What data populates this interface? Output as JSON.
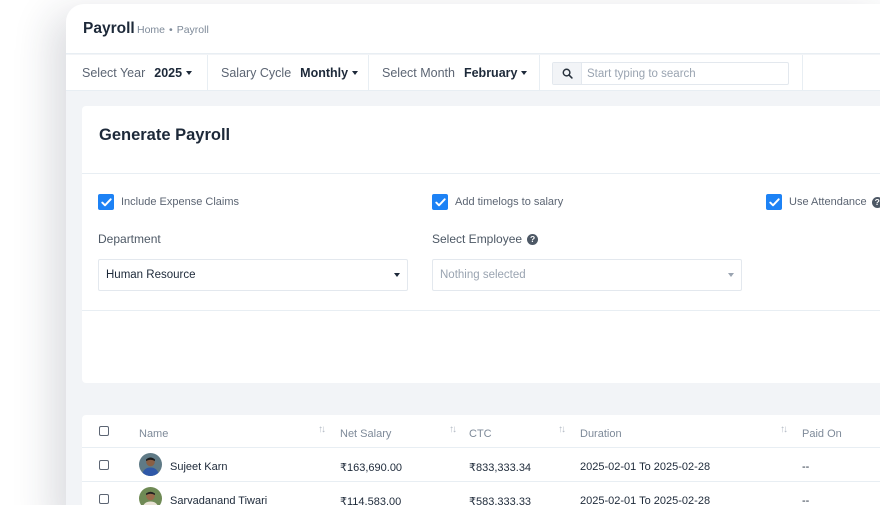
{
  "header": {
    "title": "Payroll",
    "breadcrumb": {
      "home": "Home",
      "separator": "•",
      "current": "Payroll"
    }
  },
  "filters": {
    "year": {
      "label": "Select Year",
      "value": "2025"
    },
    "cycle": {
      "label": "Salary Cycle",
      "value": "Monthly"
    },
    "month": {
      "label": "Select Month",
      "value": "February"
    },
    "search": {
      "placeholder": "Start typing to search"
    }
  },
  "generate": {
    "title": "Generate Payroll",
    "options": [
      {
        "label": "Include Expense Claims",
        "checked": true
      },
      {
        "label": "Add timelogs to salary",
        "checked": true
      },
      {
        "label": "Use Attendance",
        "checked": true
      }
    ],
    "department": {
      "label": "Department",
      "value": "Human Resource"
    },
    "employee": {
      "label": "Select Employee",
      "placeholder": "Nothing selected"
    }
  },
  "table": {
    "columns": [
      "Name",
      "Net Salary",
      "CTC",
      "Duration",
      "Paid On"
    ],
    "rows": [
      {
        "name": "Sujeet Karn",
        "net_salary": "₹163,690.00",
        "ctc": "₹833,333.34",
        "duration": "2025-02-01 To 2025-02-28",
        "paid_on": "--"
      },
      {
        "name": "Sarvadanand Tiwari",
        "net_salary": "₹114,583.00",
        "ctc": "₹583,333.33",
        "duration": "2025-02-01 To 2025-02-28",
        "paid_on": "--"
      }
    ]
  },
  "colors": {
    "accent": "#1d82f5",
    "background": "#f2f4f7",
    "text": "#1d2939",
    "muted": "#7e8a99"
  },
  "icons": [
    "search-icon",
    "caret-down-icon",
    "check-icon",
    "help-icon",
    "sort-icon",
    "avatar"
  ]
}
